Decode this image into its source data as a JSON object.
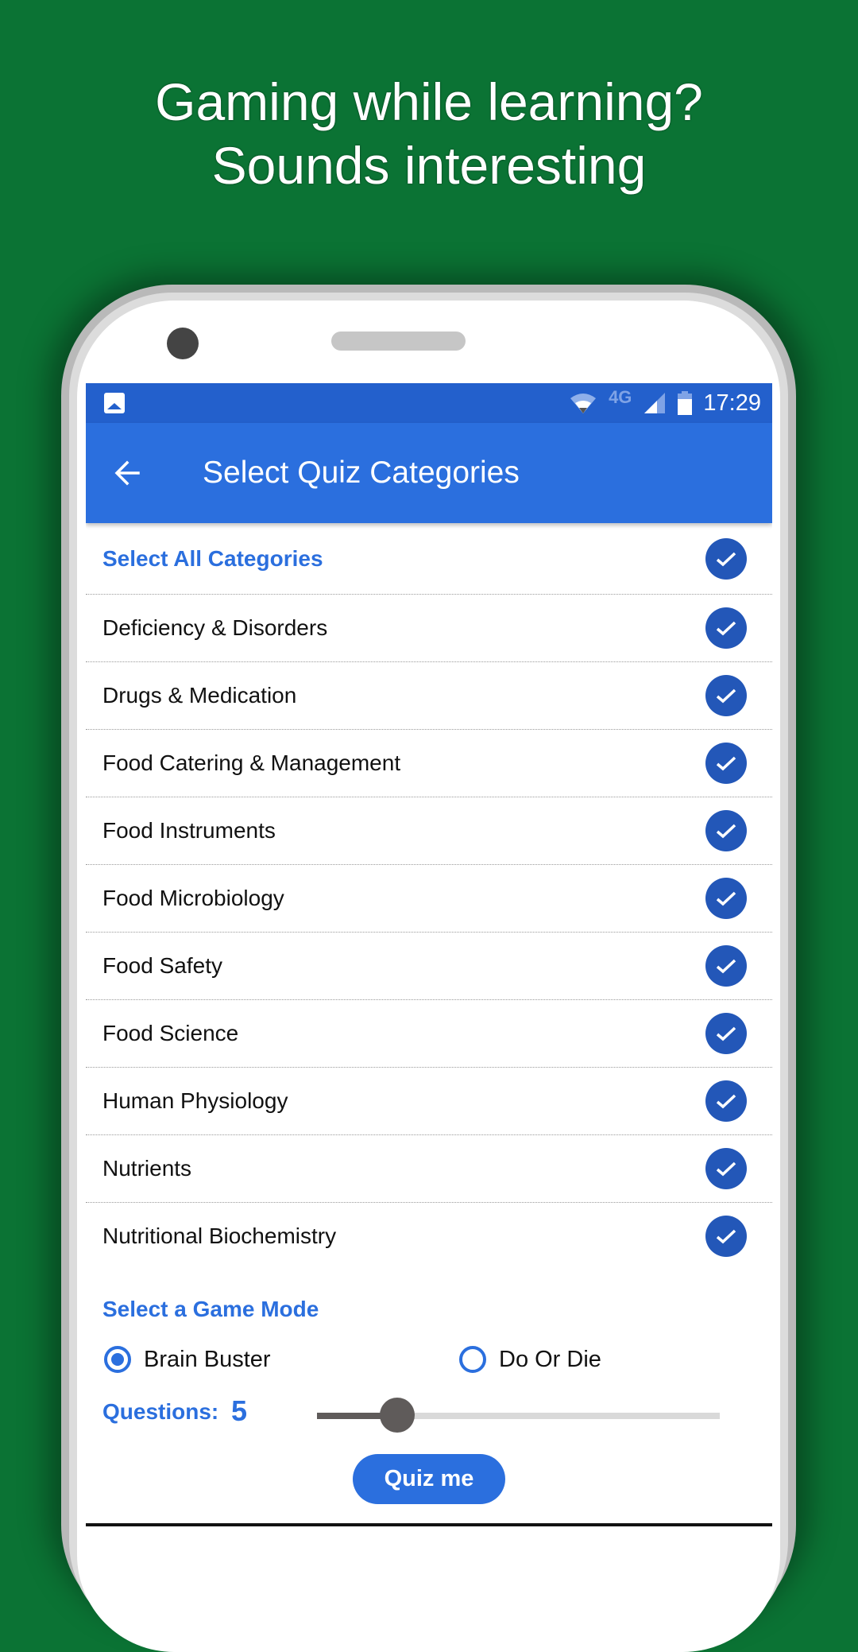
{
  "promo": {
    "headline_line1": "Gaming while learning?",
    "headline_line2": "Sounds interesting"
  },
  "status_bar": {
    "left_icon": "image-icon",
    "icons": [
      "wifi-icon",
      "signal-icon",
      "battery-icon"
    ],
    "network_label": "4G",
    "time": "17:29"
  },
  "app_bar": {
    "back_icon": "arrow-left-icon",
    "title": "Select Quiz Categories"
  },
  "categories": {
    "select_all": {
      "label": "Select All Categories",
      "checked": true
    },
    "items": [
      {
        "label": "Deficiency & Disorders",
        "checked": true
      },
      {
        "label": "Drugs & Medication",
        "checked": true
      },
      {
        "label": "Food Catering & Management",
        "checked": true
      },
      {
        "label": "Food Instruments",
        "checked": true
      },
      {
        "label": "Food Microbiology",
        "checked": true
      },
      {
        "label": "Food Safety",
        "checked": true
      },
      {
        "label": "Food Science",
        "checked": true
      },
      {
        "label": "Human Physiology",
        "checked": true
      },
      {
        "label": "Nutrients",
        "checked": true
      },
      {
        "label": "Nutritional Biochemistry",
        "checked": true
      }
    ]
  },
  "game_mode": {
    "title": "Select a Game Mode",
    "options": [
      {
        "label": "Brain Buster",
        "selected": true
      },
      {
        "label": "Do Or Die",
        "selected": false
      }
    ]
  },
  "questions": {
    "label": "Questions:",
    "value": "5",
    "slider_fraction": 0.2
  },
  "actions": {
    "quiz_me_label": "Quiz me"
  },
  "colors": {
    "background_green": "#0b7334",
    "primary_blue": "#2b6fde",
    "status_bar_blue": "#2360cc",
    "check_blue": "#2357b8"
  }
}
